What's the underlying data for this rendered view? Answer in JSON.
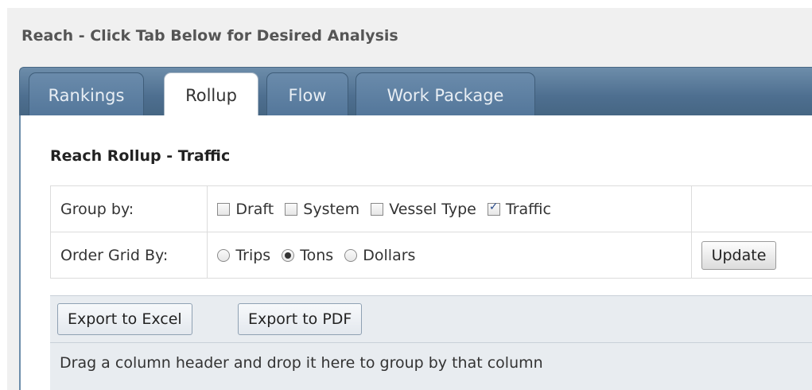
{
  "header": {
    "title": "Reach - Click Tab Below for Desired Analysis"
  },
  "tabs": [
    {
      "label": "Rankings",
      "active": false
    },
    {
      "label": "Rollup",
      "active": true
    },
    {
      "label": "Flow",
      "active": false
    },
    {
      "label": "Work Package",
      "active": false
    }
  ],
  "section": {
    "title": "Reach Rollup - Traffic"
  },
  "group_by": {
    "label": "Group by:",
    "options": [
      {
        "label": "Draft",
        "checked": false
      },
      {
        "label": "System",
        "checked": false
      },
      {
        "label": "Vessel Type",
        "checked": false
      },
      {
        "label": "Traffic",
        "checked": true
      }
    ]
  },
  "order_by": {
    "label": "Order Grid By:",
    "options": [
      {
        "label": "Trips",
        "selected": false
      },
      {
        "label": "Tons",
        "selected": true
      },
      {
        "label": "Dollars",
        "selected": false
      }
    ],
    "update_label": "Update"
  },
  "toolbar": {
    "export_excel_label": "Export to Excel",
    "export_pdf_label": "Export to PDF"
  },
  "grid": {
    "group_hint": "Drag a column header and drop it here to group by that column"
  }
}
